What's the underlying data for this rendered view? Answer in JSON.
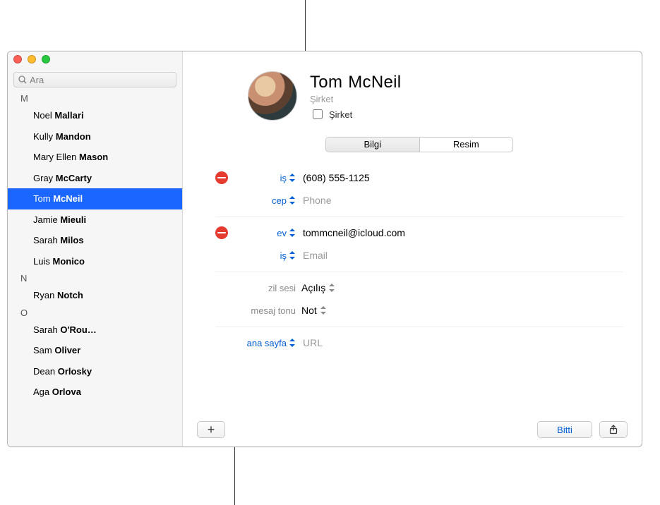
{
  "search": {
    "placeholder": "Ara"
  },
  "sections": {
    "M": {
      "header": "M",
      "items": [
        {
          "first": "Noel",
          "last": "Mallari"
        },
        {
          "first": "Kully",
          "last": "Mandon"
        },
        {
          "first": "Mary Ellen",
          "last": "Mason"
        },
        {
          "first": "Gray",
          "last": "McCarty"
        },
        {
          "first": "Tom",
          "last": "McNeil",
          "selected": true
        },
        {
          "first": "Jamie",
          "last": "Mieuli"
        },
        {
          "first": "Sarah",
          "last": "Milos"
        },
        {
          "first": "Luis",
          "last": "Monico"
        }
      ]
    },
    "N": {
      "header": "N",
      "items": [
        {
          "first": "Ryan",
          "last": "Notch"
        }
      ]
    },
    "O": {
      "header": "O",
      "items": [
        {
          "first": "Sarah",
          "last": "O'Rou…"
        },
        {
          "first": "Sam",
          "last": "Oliver"
        },
        {
          "first": "Dean",
          "last": "Orlosky"
        },
        {
          "first": "Aga",
          "last": "Orlova"
        }
      ]
    }
  },
  "card": {
    "first_name": "Tom",
    "last_name": "McNeil",
    "company_placeholder": "Şirket",
    "company_checkbox_label": "Şirket",
    "tabs": {
      "info": "Bilgi",
      "image": "Resim"
    },
    "fields": {
      "phone_work_label": "iş",
      "phone_work_value": "(608) 555-1125",
      "phone_mobile_label": "cep",
      "phone_mobile_placeholder": "Phone",
      "email_home_label": "ev",
      "email_home_value": "tommcneil@icloud.com",
      "email_work_label": "iş",
      "email_work_placeholder": "Email",
      "ringtone_label": "zil sesi",
      "ringtone_value": "Açılış",
      "texttone_label": "mesaj tonu",
      "texttone_value": "Not",
      "homepage_label": "ana sayfa",
      "homepage_placeholder": "URL"
    },
    "buttons": {
      "add": "+",
      "done": "Bitti"
    }
  }
}
